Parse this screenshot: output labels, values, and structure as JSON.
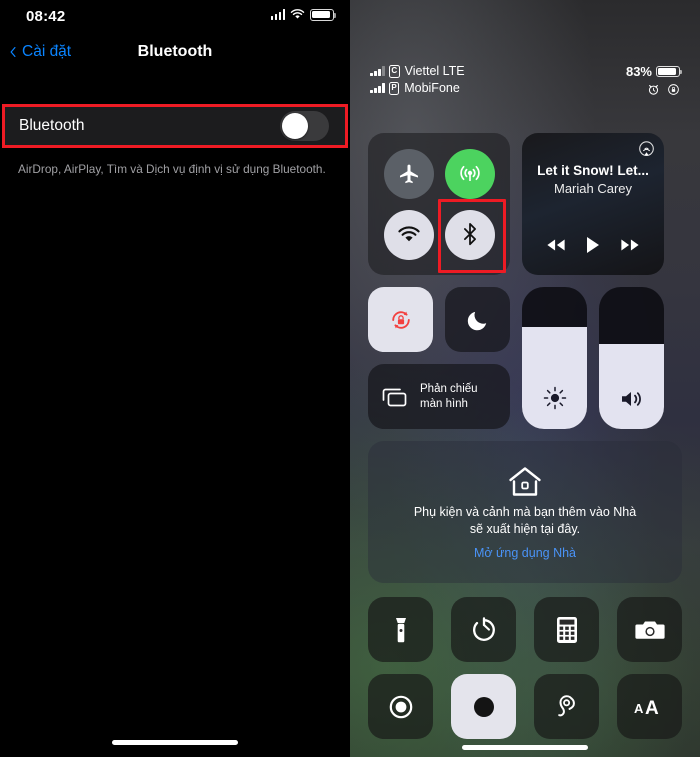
{
  "settings": {
    "status_bar": {
      "time": "08:42",
      "signal_icon": "cellular-signal-icon",
      "wifi_icon": "wifi-icon",
      "battery_icon": "battery-icon",
      "battery_level": 83
    },
    "nav": {
      "back_label": "Cài đặt",
      "back_icon": "chevron-left-icon",
      "title": "Bluetooth"
    },
    "bluetooth_row": {
      "label": "Bluetooth",
      "toggle_state": "off",
      "highlight_color": "#ee1b24"
    },
    "footnote": "AirDrop, AirPlay, Tìm và Dịch vụ định vị sử dụng Bluetooth."
  },
  "control_center": {
    "status": {
      "carriers": [
        {
          "name": "Viettel LTE",
          "sim_badge": "C",
          "bars": 3
        },
        {
          "name": "MobiFone",
          "sim_badge": "P",
          "bars": 4
        }
      ],
      "battery_percent": "83%",
      "battery_level": 83,
      "alarm_icon": "alarm-clock-icon",
      "rotation_lock_icon": "rotation-lock-icon"
    },
    "connectivity": {
      "airplane": {
        "name": "airplane-mode-icon",
        "label": "Chế độ máy bay",
        "state": "off"
      },
      "cellular": {
        "name": "cellular-data-icon",
        "label": "Dữ liệu di động",
        "state": "on"
      },
      "wifi": {
        "name": "wifi-icon",
        "label": "Wi-Fi",
        "state": "on"
      },
      "bluetooth": {
        "name": "bluetooth-icon",
        "label": "Bluetooth",
        "state": "on",
        "highlighted": true
      }
    },
    "media": {
      "airplay_icon": "airplay-audio-icon",
      "title": "Let it Snow! Let...",
      "artist": "Mariah Carey",
      "prev_icon": "rewind-icon",
      "play_icon": "play-icon",
      "next_icon": "fast-forward-icon"
    },
    "controls": {
      "rotation_lock": {
        "icon": "rotation-lock-icon",
        "state": "on",
        "accent": "#f3403f"
      },
      "do_not_disturb": {
        "icon": "moon-icon",
        "state": "off"
      },
      "screen_mirroring": {
        "icon": "screen-mirroring-icon",
        "label_line1": "Phản chiếu",
        "label_line2": "màn hình"
      },
      "brightness": {
        "icon": "brightness-icon",
        "value": 72
      },
      "volume": {
        "icon": "volume-icon",
        "value": 60
      }
    },
    "home": {
      "icon": "home-house-icon",
      "text_line1": "Phụ kiện và cảnh mà bạn thêm vào Nhà",
      "text_line2": "sẽ xuất hiện tại đây.",
      "link": "Mở ứng dụng Nhà"
    },
    "tiles": [
      {
        "icon": "flashlight-icon",
        "label": "Đèn pin",
        "state": "off"
      },
      {
        "icon": "timer-icon",
        "label": "Hẹn giờ",
        "state": "off"
      },
      {
        "icon": "calculator-icon",
        "label": "Máy tính",
        "state": "off"
      },
      {
        "icon": "camera-icon",
        "label": "Máy ảnh",
        "state": "off"
      },
      {
        "icon": "screen-record-icon",
        "label": "Ghi màn hình",
        "state": "off"
      },
      {
        "icon": "dark-mode-icon",
        "label": "Chế độ tối",
        "state": "on"
      },
      {
        "icon": "hearing-icon",
        "label": "Thính giác",
        "state": "off"
      },
      {
        "icon": "text-size-icon",
        "label": "Cỡ chữ",
        "state": "off"
      }
    ]
  }
}
